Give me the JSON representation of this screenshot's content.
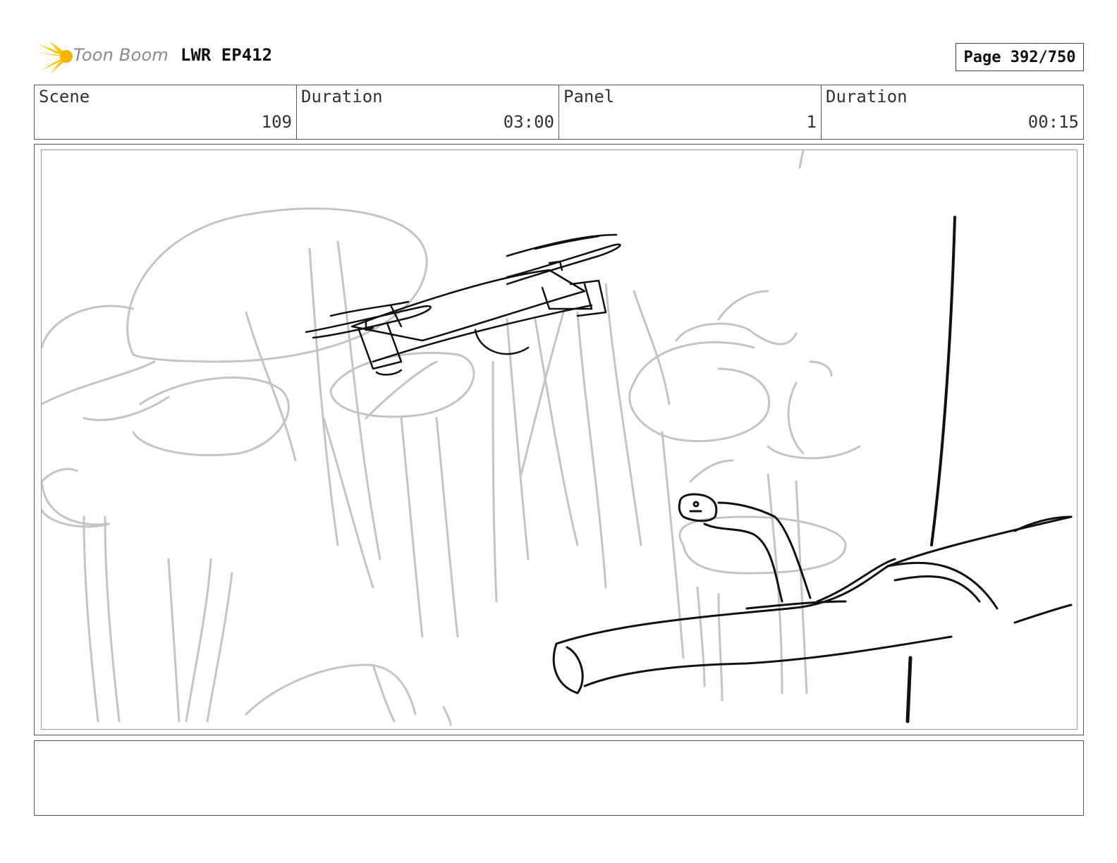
{
  "header": {
    "logo_text": "Toon Boom",
    "project": "LWR EP412",
    "page": "Page 392/750"
  },
  "info": {
    "scene_label": "Scene",
    "scene_value": "109",
    "duration_label": "Duration",
    "duration_value": "03:00",
    "panel_label": "Panel",
    "panel_value": "1",
    "panel_duration_label": "Duration",
    "panel_duration_value": "00:15"
  },
  "colors": {
    "logo_burst": "#f5c518",
    "sketch_light": "#c4c4c4",
    "sketch_dark": "#111111"
  },
  "icons": {
    "logo": "sunburst-icon"
  },
  "notes": ""
}
